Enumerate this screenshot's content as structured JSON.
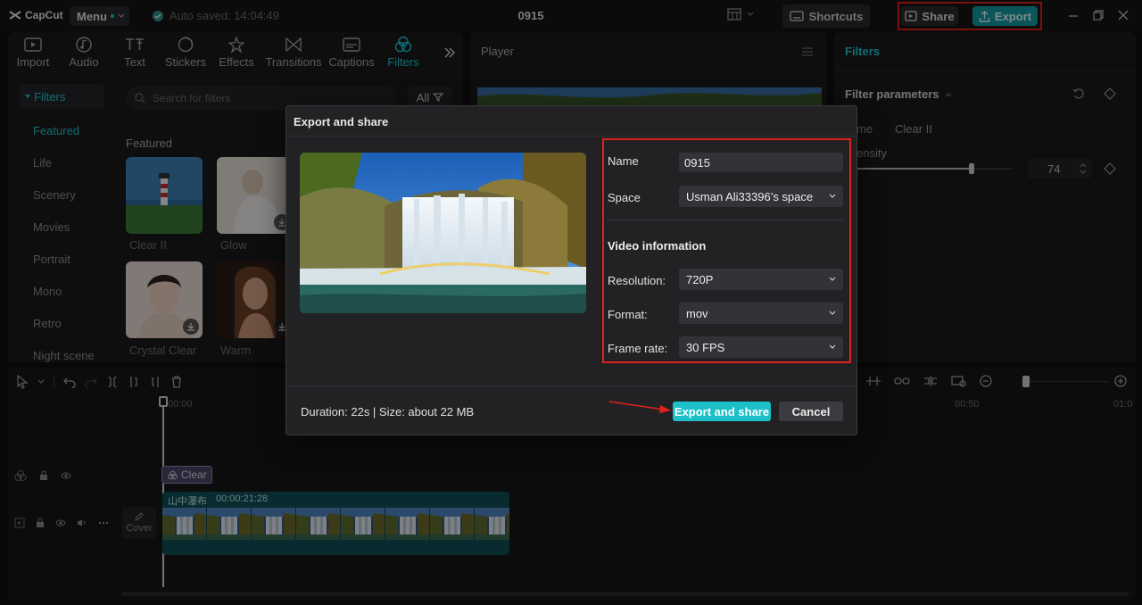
{
  "app": {
    "logo_text": "CapCut",
    "menu_label": "Menu",
    "autosave": "Auto saved: 14:04:49",
    "project_title": "0915"
  },
  "topbar": {
    "shortcuts_label": "Shortcuts",
    "share_label": "Share",
    "export_label": "Export"
  },
  "toolbar": {
    "tabs": [
      {
        "label": "Import",
        "icon": "import-icon"
      },
      {
        "label": "Audio",
        "icon": "audio-icon"
      },
      {
        "label": "Text",
        "icon": "text-icon"
      },
      {
        "label": "Stickers",
        "icon": "stickers-icon"
      },
      {
        "label": "Effects",
        "icon": "effects-icon"
      },
      {
        "label": "Transitions",
        "icon": "transitions-icon"
      },
      {
        "label": "Captions",
        "icon": "captions-icon"
      },
      {
        "label": "Filters",
        "icon": "filters-icon",
        "active": true
      }
    ]
  },
  "filters_sidebar": {
    "header": "Filters",
    "categories": [
      "Featured",
      "Life",
      "Scenery",
      "Movies",
      "Portrait",
      "Mono",
      "Retro",
      "Night scene"
    ],
    "active": "Featured"
  },
  "filters_browser": {
    "search_placeholder": "Search for filters",
    "all_label": "All",
    "section_title": "Featured",
    "items": [
      "Clear II",
      "Glow",
      "Crystal Clear",
      "Warm"
    ]
  },
  "player": {
    "title": "Player"
  },
  "filters_panel": {
    "title": "Filters",
    "params_title": "Filter parameters",
    "name_label": "me",
    "name_value": "Clear II",
    "intensity_label": "ensity",
    "intensity_value": "74",
    "intensity_fraction": 0.74
  },
  "timeline": {
    "time_start": "00:00",
    "time_mark": "00:50",
    "time_end": "01:0",
    "filter_clip_label": "Clear",
    "video_clip_name": "山中瀑布",
    "video_clip_duration": "00:00:21:28",
    "cover_label": "Cover"
  },
  "dialog": {
    "title": "Export and share",
    "name_label": "Name",
    "name_value": "0915",
    "space_label": "Space",
    "space_value": "Usman Ali33396’s space",
    "video_info_heading": "Video information",
    "resolution_label": "Resolution:",
    "resolution_value": "720P",
    "format_label": "Format:",
    "format_value": "mov",
    "framerate_label": "Frame rate:",
    "framerate_value": "30 FPS",
    "duration_text": "Duration: 22s | Size: about 22 MB",
    "export_share_label": "Export and share",
    "cancel_label": "Cancel"
  },
  "colors": {
    "accent": "#1ec8d2",
    "highlight_frame": "#e0201b",
    "export_button": "#139ca3"
  }
}
